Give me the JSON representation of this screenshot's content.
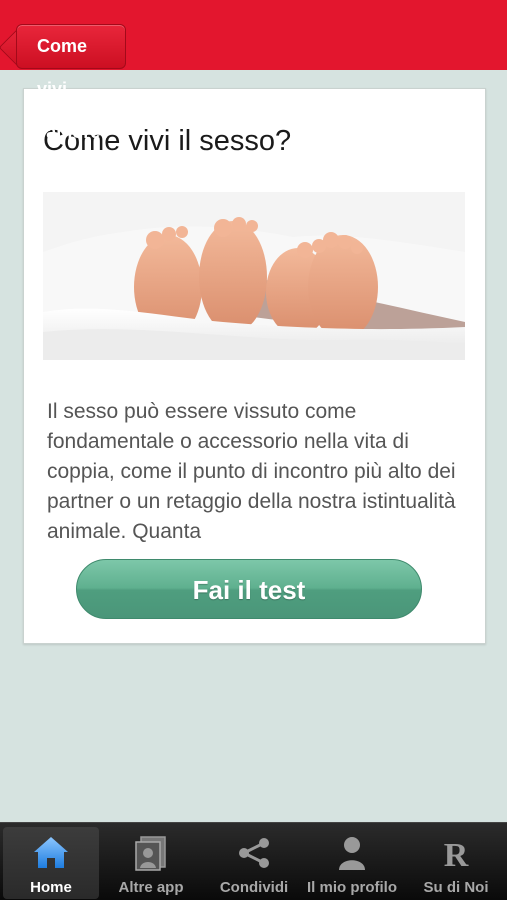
{
  "header": {
    "back_label": "Come vivi l'amore?",
    "color": "#e3162e"
  },
  "card": {
    "title": "Come vivi il sesso?",
    "image_icon": "feet-under-sheets-photo",
    "text": "Il sesso può essere vissuto come fondamentale o accessorio nella vita di coppia, come il punto di incontro più alto dei partner o un retaggio della nostra istintualità animale. Quanta",
    "cta_label": "Fai il test",
    "cta_color": "#5fb08f"
  },
  "tabbar": {
    "items": [
      {
        "label": "Home",
        "icon": "home-icon",
        "active": true
      },
      {
        "label": "Altre app",
        "icon": "apps-icon",
        "active": false
      },
      {
        "label": "Condividi",
        "icon": "share-icon",
        "active": false
      },
      {
        "label": "Il mio profilo",
        "icon": "profile-icon",
        "active": false
      },
      {
        "label": "Su di Noi",
        "icon": "about-icon",
        "active": false
      }
    ]
  }
}
